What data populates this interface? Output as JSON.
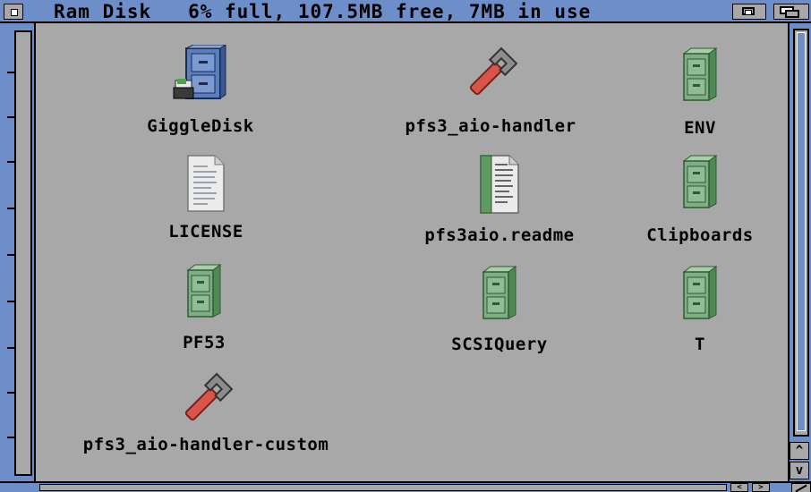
{
  "window": {
    "title": "Ram Disk   6% full, 107.5MB free, 7MB in use"
  },
  "scroll": {
    "up_arrow": "^",
    "down_arrow": "v",
    "left_arrow": "<",
    "right_arrow": ">"
  },
  "icons": [
    {
      "label": "GiggleDisk",
      "icon": "disk-drawer-icon"
    },
    {
      "label": "pfs3_aio-handler",
      "icon": "wrench-tool-icon"
    },
    {
      "label": "ENV",
      "icon": "drawer-icon"
    },
    {
      "label": "LICENSE",
      "icon": "document-icon"
    },
    {
      "label": "pfs3aio.readme",
      "icon": "text-document-icon"
    },
    {
      "label": "Clipboards",
      "icon": "drawer-icon"
    },
    {
      "label": "PF53",
      "icon": "drawer-icon"
    },
    {
      "label": "SCSIQuery",
      "icon": "drawer-icon"
    },
    {
      "label": "T",
      "icon": "drawer-icon"
    },
    {
      "label": "pfs3_aio-handler-custom",
      "icon": "wrench-tool-icon"
    }
  ],
  "colors": {
    "window_border": "#6d8ec8",
    "background": "#a8a8a8",
    "drawer_green": "#7fae84",
    "wrench_red": "#d9554a"
  }
}
